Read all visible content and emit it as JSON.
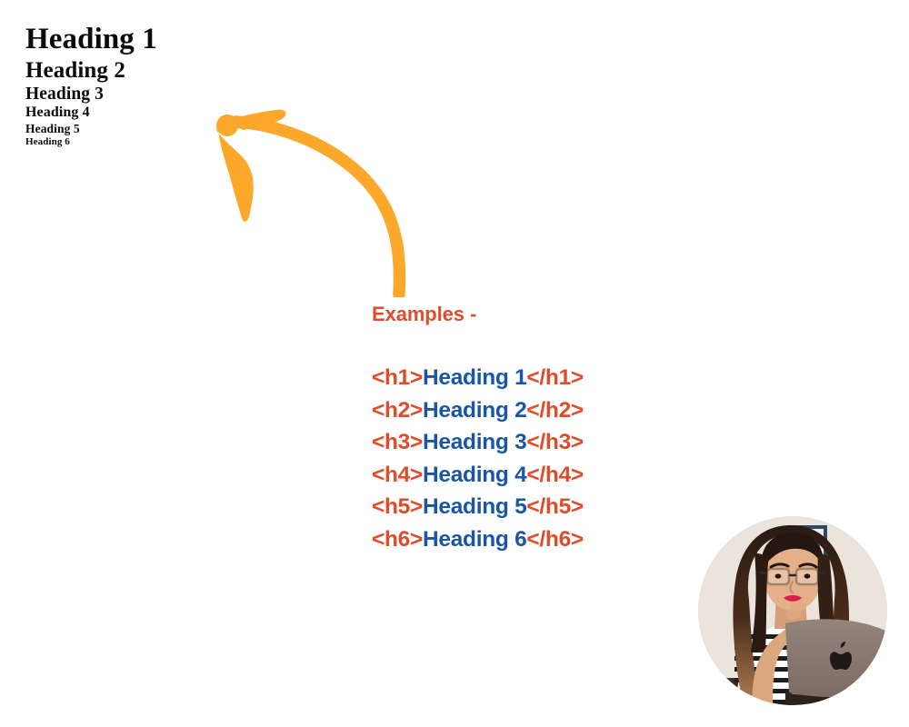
{
  "slide": {
    "background_color": "#ffffff",
    "accent_orange": "#FBA82B",
    "tag_color": "#E04C28",
    "content_color": "#1A56A6",
    "heading_text_color": "#0b0b0b"
  },
  "headings_demo": {
    "items": [
      {
        "level": "h1",
        "label": "Heading 1"
      },
      {
        "level": "h2",
        "label": "Heading 2"
      },
      {
        "level": "h3",
        "label": "Heading 3"
      },
      {
        "level": "h4",
        "label": "Heading 4"
      },
      {
        "level": "h5",
        "label": "Heading 5"
      },
      {
        "level": "h6",
        "label": "Heading 6"
      }
    ]
  },
  "annotation": {
    "arrow_icon": "curved-arrow-up-left-icon",
    "color": "#FBA82B"
  },
  "examples": {
    "title": "Examples -",
    "lines": [
      {
        "open": "<h1>",
        "content": "Heading 1",
        "close": "</h1>"
      },
      {
        "open": "<h2>",
        "content": "Heading 2",
        "close": "</h2>"
      },
      {
        "open": "<h3>",
        "content": "Heading 3",
        "close": "</h3>"
      },
      {
        "open": "<h4>",
        "content": "Heading 4",
        "close": "</h4>"
      },
      {
        "open": "<h5>",
        "content": "Heading 5",
        "close": "</h5>"
      },
      {
        "open": "<h6>",
        "content": "Heading 6",
        "close": "</h6>"
      }
    ]
  },
  "presenter": {
    "photo_alt": "woman-with-glasses-thinking-behind-laptop"
  }
}
